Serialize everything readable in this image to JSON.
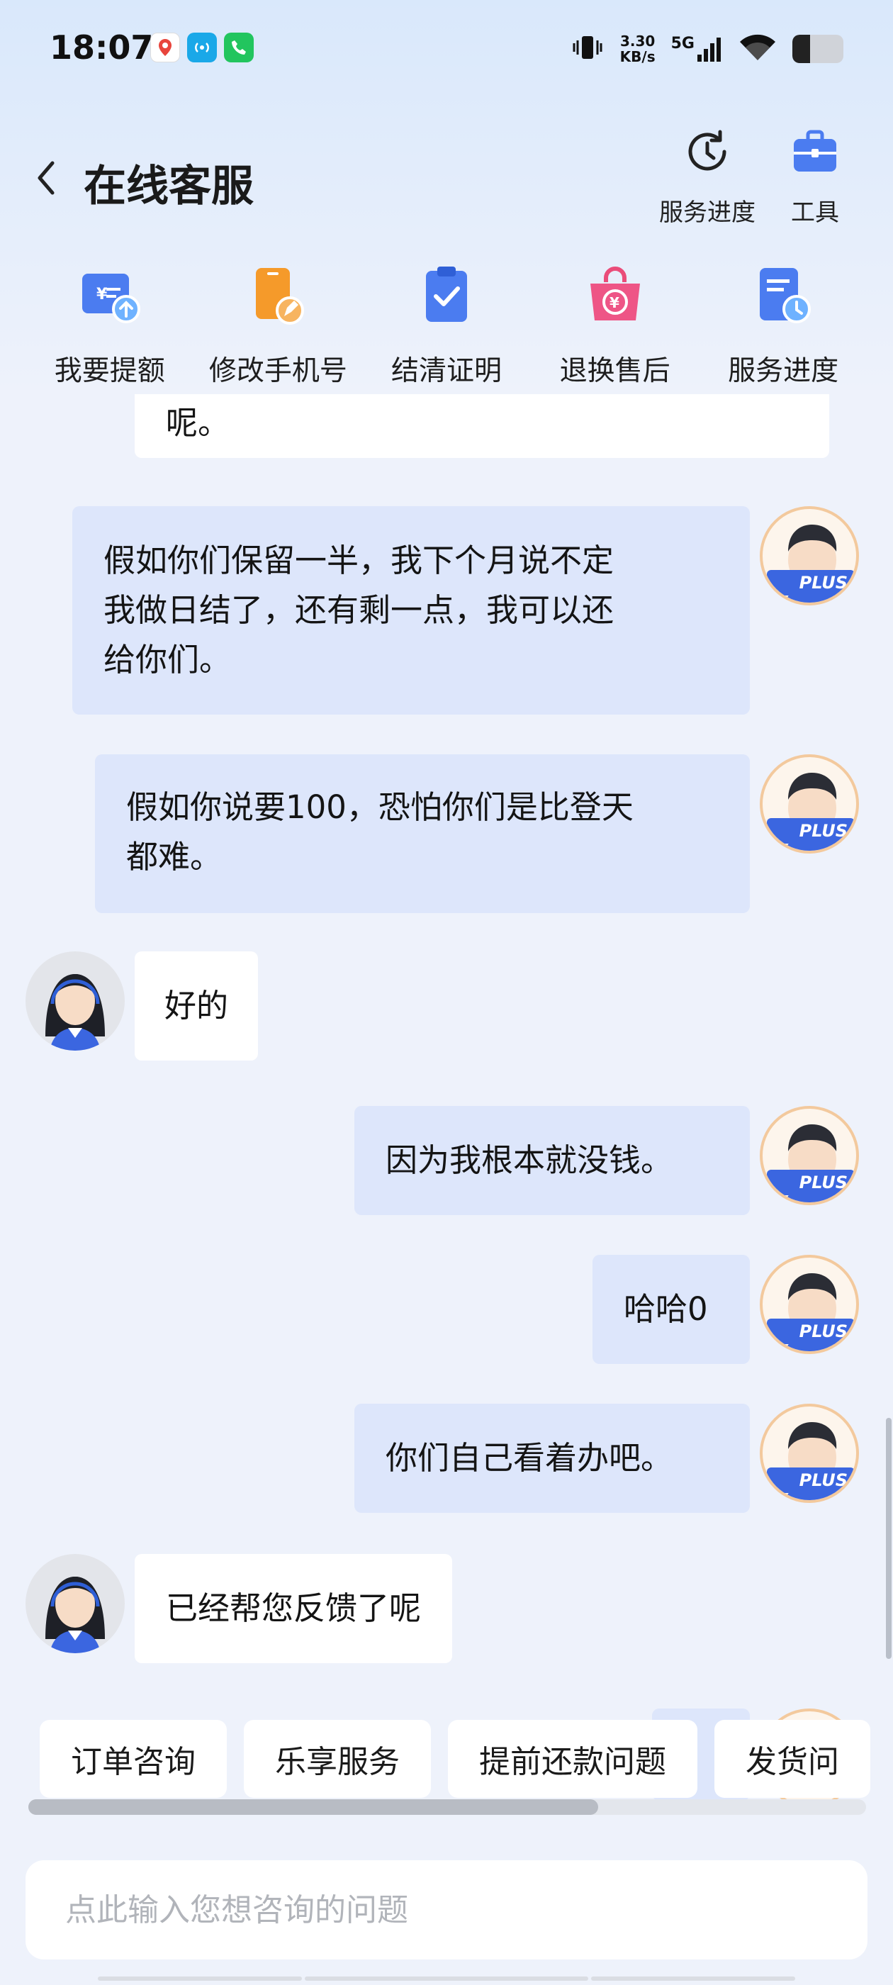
{
  "status": {
    "time": "18:07",
    "net_speed_value": "3.30",
    "net_speed_unit": "KB/s",
    "network_type": "5G",
    "battery_level": 0.35,
    "app_icons": [
      "maps-app-icon",
      "hotspot-app-icon",
      "phone-app-icon"
    ]
  },
  "header": {
    "title": "在线客服",
    "actions": [
      {
        "label": "服务进度",
        "icon": "clock-history-icon"
      },
      {
        "label": "工具",
        "icon": "toolbox-icon"
      }
    ]
  },
  "quick_entries": [
    {
      "label": "我要提额",
      "icon": "wallet-upgrade-icon"
    },
    {
      "label": "修改手机号",
      "icon": "edit-phone-icon"
    },
    {
      "label": "结清证明",
      "icon": "clipboard-check-icon"
    },
    {
      "label": "退换售后",
      "icon": "shopping-bag-refund-icon"
    },
    {
      "label": "服务进度",
      "icon": "document-clock-icon"
    }
  ],
  "messages": [
    {
      "sender": "agent",
      "text": "呢。",
      "partial": true
    },
    {
      "sender": "user",
      "text": "假如你们保留一半，我下个月说不定我做日结了，还有剩一点，我可以还给你们。",
      "lines": [
        "假如你们保留一半，我下个月说不定",
        "我做日结了，还有剩一点，我可以还",
        "给你们。"
      ]
    },
    {
      "sender": "user",
      "text": "假如你说要100，恐怕你们是比登天都难。",
      "lines": [
        "假如你说要100，恐怕你们是比登天",
        "都难。"
      ]
    },
    {
      "sender": "agent",
      "text": "好的"
    },
    {
      "sender": "user",
      "text": "因为我根本就没钱。"
    },
    {
      "sender": "user",
      "text": "哈哈0"
    },
    {
      "sender": "user",
      "text": "你们自己看着办吧。"
    },
    {
      "sender": "agent",
      "text": "已经帮您反馈了呢"
    }
  ],
  "user_badge": "PLUS",
  "chips": [
    "订单咨询",
    "乐享服务",
    "提前还款问题",
    "发货问"
  ],
  "chips_scroll_fraction": 0.68,
  "input": {
    "placeholder": "点此输入您想咨询的问题",
    "value": ""
  },
  "colors": {
    "accent": "#3b66e0",
    "user_bubble": "#dde6fb",
    "agent_bubble": "#ffffff",
    "background": "#eef2fb"
  }
}
